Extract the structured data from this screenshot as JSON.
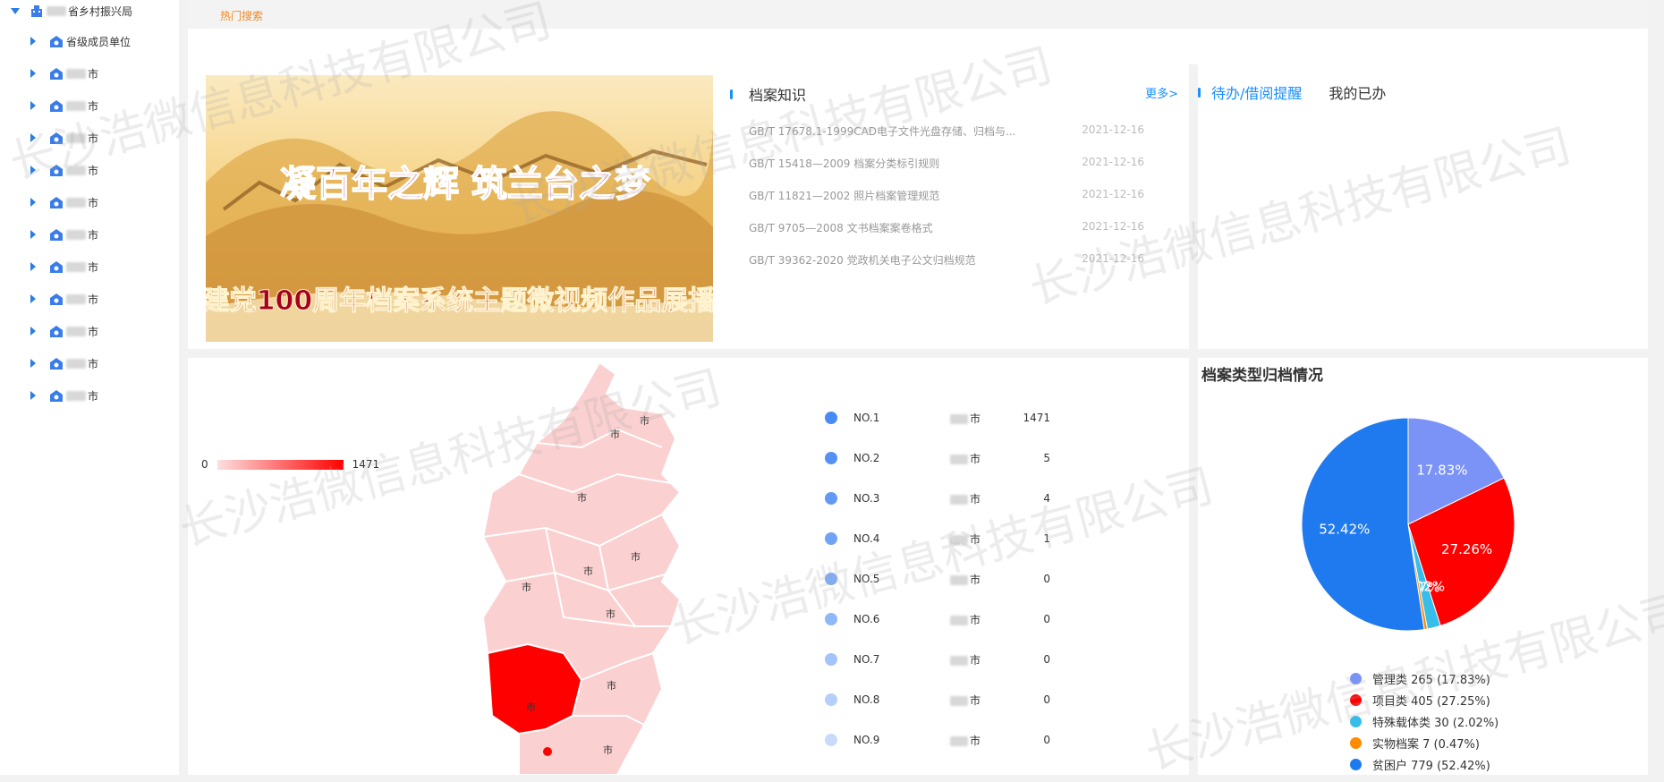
{
  "sidebar": {
    "root_label": "省乡村振兴局",
    "items": [
      {
        "label": "省级成员单位"
      },
      {
        "label": "市"
      },
      {
        "label": "市"
      },
      {
        "label": "市"
      },
      {
        "label": "市"
      },
      {
        "label": "市"
      },
      {
        "label": "市"
      },
      {
        "label": "市"
      },
      {
        "label": "市"
      },
      {
        "label": "市"
      },
      {
        "label": "市"
      },
      {
        "label": "市"
      }
    ]
  },
  "topbar": {
    "hot_search": "热门搜索"
  },
  "banner": {
    "line1": "凝百年之辉 筑兰台之梦",
    "line2": "建党100周年档案系统主题微视频作品展播"
  },
  "knowledge": {
    "title": "档案知识",
    "more": "更多>",
    "items": [
      {
        "title": "GB/T 17678.1-1999CAD电子文件光盘存储、归档与...",
        "date": "2021-12-16"
      },
      {
        "title": " GB/T 15418—2009 档案分类标引规则",
        "date": "2021-12-16"
      },
      {
        "title": "GB/T 11821—2002 照片档案管理规范",
        "date": "2021-12-16"
      },
      {
        "title": "GB/T 9705—2008 文书档案案卷格式",
        "date": "2021-12-16"
      },
      {
        "title": "GB/T 39362-2020 党政机关电子公文归档规范",
        "date": "2021-12-16"
      }
    ]
  },
  "todo": {
    "tab_active": "待办/借阅提醒",
    "tab_done": "我的已办"
  },
  "map": {
    "legend_min": "0",
    "legend_max": "1471",
    "city_suffix": "市",
    "ranking": [
      {
        "no": "NO.1",
        "city": "市",
        "value": "1471",
        "color": "#4a8af4"
      },
      {
        "no": "NO.2",
        "city": "市",
        "value": "5",
        "color": "#5690f4"
      },
      {
        "no": "NO.3",
        "city": "市",
        "value": "4",
        "color": "#6299f5"
      },
      {
        "no": "NO.4",
        "city": "市",
        "value": "1",
        "color": "#70a2f6"
      },
      {
        "no": "NO.5",
        "city": "市",
        "value": "0",
        "color": "#80acf7"
      },
      {
        "no": "NO.6",
        "city": "市",
        "value": "0",
        "color": "#90b7f8"
      },
      {
        "no": "NO.7",
        "city": "市",
        "value": "0",
        "color": "#a3c3f9"
      },
      {
        "no": "NO.8",
        "city": "市",
        "value": "0",
        "color": "#b6cffa"
      },
      {
        "no": "NO.9",
        "city": "市",
        "value": "0",
        "color": "#c9dbfb"
      }
    ]
  },
  "watermark": "长沙浩微信息科技有限公司",
  "chart_data": {
    "type": "pie",
    "title": "档案类型归档情况",
    "slices": [
      {
        "name": "管理类",
        "value": 265,
        "percent": "17.83%",
        "legend": "管理类 265 (17.83%)",
        "color": "#7b93f7"
      },
      {
        "name": "项目类",
        "value": 405,
        "percent": "27.26%",
        "legend": "项目类 405 (27.25%)",
        "color": "#ff0000"
      },
      {
        "name": "特殊载体类",
        "value": 30,
        "percent": "2.02%",
        "legend": "特殊载体类 30 (2.02%)",
        "color": "#36bde9"
      },
      {
        "name": "实物档案",
        "value": 7,
        "percent": "0.47%",
        "legend": "实物档案 7 (0.47%)",
        "color": "#ff8c00"
      },
      {
        "name": "贫困户",
        "value": 779,
        "percent": "52.42%",
        "legend": "贫困户 779 (52.42%)",
        "color": "#1f7af0"
      }
    ]
  }
}
